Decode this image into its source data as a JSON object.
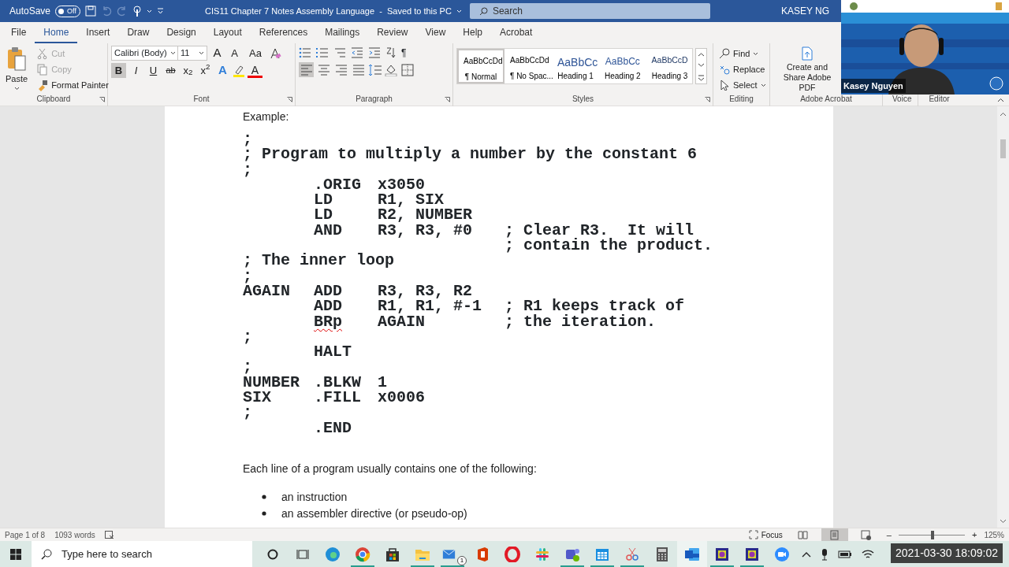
{
  "title_bar": {
    "autosave_label": "AutoSave",
    "autosave": {
      "on": false,
      "label": "Off"
    },
    "title": "CIS11 Chapter 7 Notes Assembly Language  -  Saved to this PC",
    "search": {
      "placeholder": "Search"
    },
    "user": "KASEY NG"
  },
  "tabs": [
    {
      "label": "File",
      "selected": false
    },
    {
      "label": "Home",
      "selected": true
    },
    {
      "label": "Insert",
      "selected": false
    },
    {
      "label": "Draw",
      "selected": false
    },
    {
      "label": "Design",
      "selected": false
    },
    {
      "label": "Layout",
      "selected": false
    },
    {
      "label": "References",
      "selected": false
    },
    {
      "label": "Mailings",
      "selected": false
    },
    {
      "label": "Review",
      "selected": false
    },
    {
      "label": "View",
      "selected": false
    },
    {
      "label": "Help",
      "selected": false
    },
    {
      "label": "Acrobat",
      "selected": false
    }
  ],
  "ribbon": {
    "clipboard": {
      "label": "Clipboard",
      "paste": "Paste",
      "items": [
        {
          "kind": "cut",
          "label": "Cut",
          "disabled": true
        },
        {
          "kind": "copy",
          "label": "Copy",
          "disabled": true
        },
        {
          "kind": "painter",
          "label": "Format Painter",
          "disabled": false
        }
      ]
    },
    "font": {
      "label": "Font",
      "name": "Calibri (Body)",
      "size": "11",
      "row1": [
        {
          "kind": "grow",
          "label": "A"
        },
        {
          "kind": "shrink",
          "label": "A"
        },
        {
          "kind": "case",
          "label": "Aa"
        }
      ],
      "row2": [
        {
          "kind": "bold",
          "label": "B",
          "selected": true
        },
        {
          "kind": "italic",
          "label": "I",
          "selected": false
        },
        {
          "kind": "underline",
          "label": "U",
          "selected": false
        },
        {
          "kind": "strike",
          "label": "ab",
          "selected": false
        },
        {
          "kind": "sub",
          "label": "x$_{2}$",
          "selected": false
        },
        {
          "kind": "sup",
          "label": "x$^{2}$",
          "selected": false
        }
      ],
      "effects": "A",
      "color_letter": "A"
    },
    "paragraph": {
      "label": "Paragraph",
      "marks": "¶",
      "align": [
        {
          "kind": "left",
          "selected": true
        },
        {
          "kind": "center",
          "selected": false
        },
        {
          "kind": "right",
          "selected": false
        },
        {
          "kind": "justify",
          "selected": false
        }
      ]
    },
    "styles": {
      "label": "Styles",
      "items": [
        {
          "kind": "normal",
          "preview": "AaBbCcDd",
          "label": "¶ Normal",
          "selected": true
        },
        {
          "kind": "normal",
          "preview": "AaBbCcDd",
          "label": "¶ No Spac...",
          "selected": false
        },
        {
          "kind": "heading1",
          "preview": "AaBbCc",
          "label": "Heading 1",
          "selected": false
        },
        {
          "kind": "heading2",
          "preview": "AaBbCc",
          "label": "Heading 2",
          "selected": false
        },
        {
          "kind": "heading3",
          "preview": "AaBbCcD",
          "label": "Heading 3",
          "selected": false
        }
      ]
    },
    "editing": {
      "label": "Editing",
      "items": [
        {
          "kind": "find",
          "label": "Find"
        },
        {
          "kind": "replace",
          "label": "Replace"
        },
        {
          "kind": "select",
          "label": "Select"
        }
      ]
    },
    "acrobat": {
      "label": "Adobe Acrobat",
      "button": "Create and Share Adobe PDF"
    },
    "voice": {
      "label": "Voice"
    },
    "editor": {
      "label": "Editor"
    }
  },
  "webcam": {
    "kind": "picture",
    "name": "Kasey Nguyen"
  },
  "document": {
    "intro": "Example:",
    "code": [
      {
        "kind": "comment",
        "comment": ";"
      },
      {
        "kind": "comment",
        "comment": "; Program to multiply a number by the constant 6"
      },
      {
        "kind": "comment",
        "comment": ";"
      },
      {
        "kind": "code",
        "op": ".ORIG",
        "operands": "x3050"
      },
      {
        "kind": "code",
        "op": "LD",
        "operands": "R1, SIX"
      },
      {
        "kind": "code",
        "op": "LD",
        "operands": "R2, NUMBER"
      },
      {
        "kind": "code",
        "op": "AND",
        "operands": "R3, R3, #0",
        "comment": "; Clear R3.  It will"
      },
      {
        "kind": "code",
        "comment": "; contain the product."
      },
      {
        "kind": "comment",
        "comment": "; The inner loop"
      },
      {
        "kind": "comment",
        "comment": ";"
      },
      {
        "kind": "code",
        "label": "AGAIN",
        "op": "ADD",
        "operands": "R3, R3, R2"
      },
      {
        "kind": "code",
        "op": "ADD",
        "operands": "R1, R1, #-1",
        "comment": "; R1 keeps track of"
      },
      {
        "kind": "code",
        "op": "BRp",
        "misspelled": true,
        "operands": "AGAIN",
        "comment": "; the iteration."
      },
      {
        "kind": "comment",
        "comment": ";"
      },
      {
        "kind": "code",
        "op": "HALT"
      },
      {
        "kind": "comment",
        "comment": ";"
      },
      {
        "kind": "code",
        "label": "NUMBER",
        "op": ".BLKW",
        "operands": "1"
      },
      {
        "kind": "code",
        "label": "SIX",
        "op": ".FILL",
        "operands": "x0006"
      },
      {
        "kind": "comment",
        "comment": ";"
      },
      {
        "kind": "code",
        "op": ".END"
      }
    ],
    "lead": "Each line of a program usually contains one of the following:",
    "bullets": [
      "an instruction",
      "an assembler directive (or pseudo-op)"
    ]
  },
  "status_bar": {
    "page": "Page 1 of 8",
    "words": "1093 words",
    "focus": "Focus",
    "views": [
      {
        "kind": "read",
        "selected": false
      },
      {
        "kind": "print",
        "selected": true
      },
      {
        "kind": "web",
        "selected": false
      }
    ],
    "zoom_out": "–",
    "zoom_in": "+",
    "zoom": {
      "level": 0.51
    },
    "zoom_label": "125%"
  },
  "taskbar": {
    "search": {
      "placeholder": "Type here to search"
    },
    "apps": [
      {
        "kind": "edge",
        "running": false
      },
      {
        "kind": "chrome",
        "running": true
      },
      {
        "kind": "store",
        "running": false
      },
      {
        "kind": "explorer",
        "running": true
      },
      {
        "kind": "mail",
        "running": true,
        "badge": "1"
      },
      {
        "kind": "office",
        "running": false
      },
      {
        "kind": "opera",
        "running": false
      },
      {
        "kind": "slack",
        "running": false
      },
      {
        "kind": "teams",
        "running": true
      },
      {
        "kind": "calendar",
        "running": true
      },
      {
        "kind": "snip",
        "running": true
      },
      {
        "kind": "calc",
        "running": false
      },
      {
        "kind": "word",
        "running": false,
        "selected": true
      },
      {
        "kind": "lc3",
        "running": true
      },
      {
        "kind": "lc3",
        "running": true
      },
      {
        "kind": "zoom",
        "running": false
      }
    ],
    "timestamp": "2021-03-30 18:09:02"
  }
}
